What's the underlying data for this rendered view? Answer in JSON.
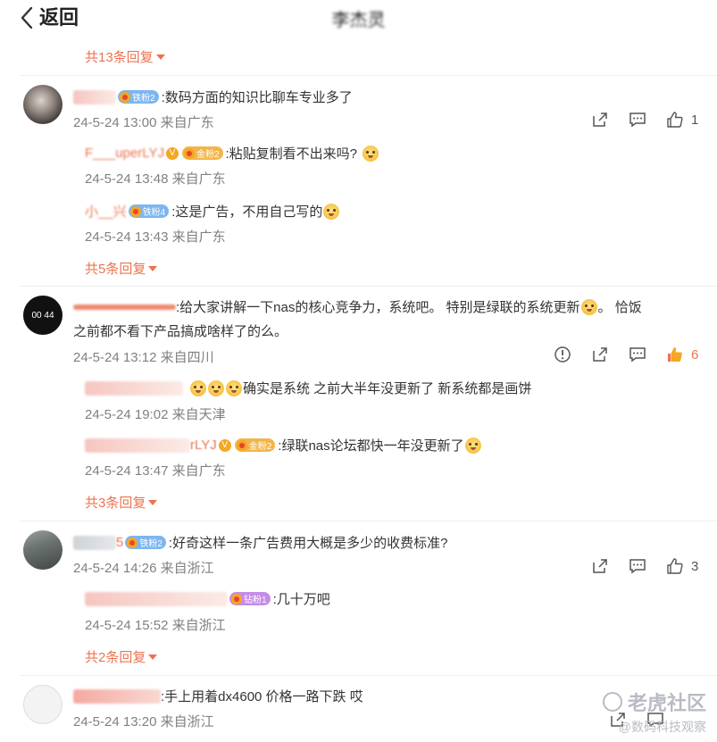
{
  "header": {
    "back_label": "返回",
    "title": "李杰灵"
  },
  "thread0": {
    "replies_label": "共13条回复"
  },
  "c1": {
    "name": "棒油_",
    "badge": "铁粉2",
    "text": ":数码方面的知识比聊车专业多了",
    "meta": "24-5-24 13:00 来自广东",
    "likes": "1",
    "replies": [
      {
        "name": "F___uperLYJ",
        "badge": "金粉2",
        "text": ":粘贴复制看不出来吗?",
        "meta": "24-5-24 13:48 来自广东"
      },
      {
        "name": "小__兴",
        "badge": "铁粉4",
        "text": ":这是广告，不用自己写的",
        "meta": "24-5-24 13:43 来自广东"
      }
    ],
    "replies_label": "共5条回复"
  },
  "c2": {
    "avatar_text": "00 44",
    "text": ":给大家讲解一下nas的核心竞争力，系统吧。 特别是绿联的系统更新",
    "text_tail": "。 恰饭",
    "text2": "之前都不看下产品搞成啥样了的么。",
    "meta": "24-5-24 13:12 来自四川",
    "likes": "6",
    "replies": [
      {
        "text": "确实是系统 之前大半年没更新了 新系统都是画饼",
        "meta": "24-5-24 19:02 来自天津"
      },
      {
        "name_tail": "rLYJ",
        "badge": "金粉2",
        "text": ":绿联nas论坛都快一年没更新了",
        "meta": "24-5-24 13:47 来自广东"
      }
    ],
    "replies_label": "共3条回复"
  },
  "c3": {
    "name_tail": "5",
    "badge": "铁粉2",
    "text": ":好奇这样一条广告费用大概是多少的收费标准?",
    "meta": "24-5-24 14:26 来自浙江",
    "likes": "3",
    "replies": [
      {
        "badge": "钻粉1",
        "text": ":几十万吧",
        "meta": "24-5-24 15:52 来自浙江"
      }
    ],
    "replies_label": "共2条回复"
  },
  "c4": {
    "text": ":手上用着dx4600 价格一路下跌 哎",
    "meta": "24-5-24 13:20 来自浙江"
  },
  "watermark": {
    "main": "老虎社区",
    "sub": "@数码科技观察"
  },
  "colors": {
    "accent": "#eb7350",
    "meta": "#808080",
    "iron_badge": "#7cb6f0",
    "gold_badge": "#f3b54a",
    "diamond_badge": "#c58ce6"
  }
}
